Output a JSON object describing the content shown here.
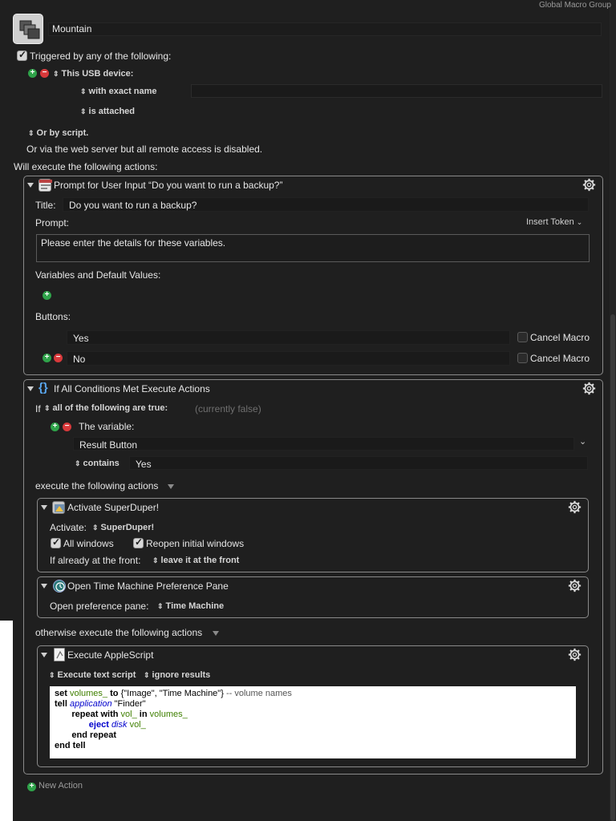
{
  "macro": {
    "group": "Global Macro Group",
    "name": "Mountain"
  },
  "trigger": {
    "triggered_label": "Triggered by any of the following:",
    "usb_device": "This USB device:",
    "with_exact_name": "with exact name",
    "is_attached": "is attached",
    "or_by_script": "Or by script.",
    "web_server_note": "Or via the web server but all remote access is disabled."
  },
  "will_execute": "Will execute the following actions:",
  "prompt_action": {
    "title": "Prompt for User Input “Do you want to run a backup?”",
    "title_label": "Title:",
    "title_value": "Do you want to run a backup?",
    "prompt_label": "Prompt:",
    "insert_token": "Insert Token",
    "prompt_value": "Please enter the details for these variables.",
    "variables_label": "Variables and Default Values:",
    "buttons_label": "Buttons:",
    "buttons": [
      {
        "label": "Yes",
        "cancel": "Cancel Macro"
      },
      {
        "label": "No",
        "cancel": "Cancel Macro"
      }
    ]
  },
  "if_action": {
    "title": "If All Conditions Met Execute Actions",
    "if_label": "If",
    "condition_mode": "all of the following are true:",
    "status": "(currently false)",
    "the_variable": "The variable:",
    "variable_name": "Result Button",
    "operator": "contains",
    "operand": "Yes",
    "then_label": "execute the following actions",
    "otherwise_label": "otherwise execute the following actions"
  },
  "activate_action": {
    "title": "Activate SuperDuper!",
    "activate_label": "Activate:",
    "app": "SuperDuper!",
    "all_windows": "All windows",
    "reopen_windows": "Reopen initial windows",
    "front_label": "If already at the front:",
    "front_option": "leave it at the front"
  },
  "timemachine_action": {
    "title": "Open Time Machine Preference Pane",
    "pane_label": "Open preference pane:",
    "pane_value": "Time Machine"
  },
  "applescript_action": {
    "title": "Execute AppleScript",
    "mode": "Execute text script",
    "results": "ignore results",
    "code": {
      "l1_set": "set",
      "l1_var": "volumes_",
      "l1_to": "to",
      "l1_list": "{\"Image\", \"Time Machine\"}",
      "l1_comment": "-- volume names",
      "l2_tell": "tell",
      "l2_app": "application",
      "l2_str": "\"Finder\"",
      "l3_repeat": "repeat with",
      "l3_var": "vol_",
      "l3_in": "in",
      "l3_list": "volumes_",
      "l4_eject": "eject",
      "l4_disk": "disk",
      "l4_var": "vol_",
      "l5_end": "end repeat",
      "l6_end": "end tell"
    }
  },
  "new_action": "New Action",
  "colors": {
    "background": "#1f1f1f",
    "panel_border": "#8a8a8a",
    "add": "#2fa34a",
    "remove": "#d8393b"
  }
}
